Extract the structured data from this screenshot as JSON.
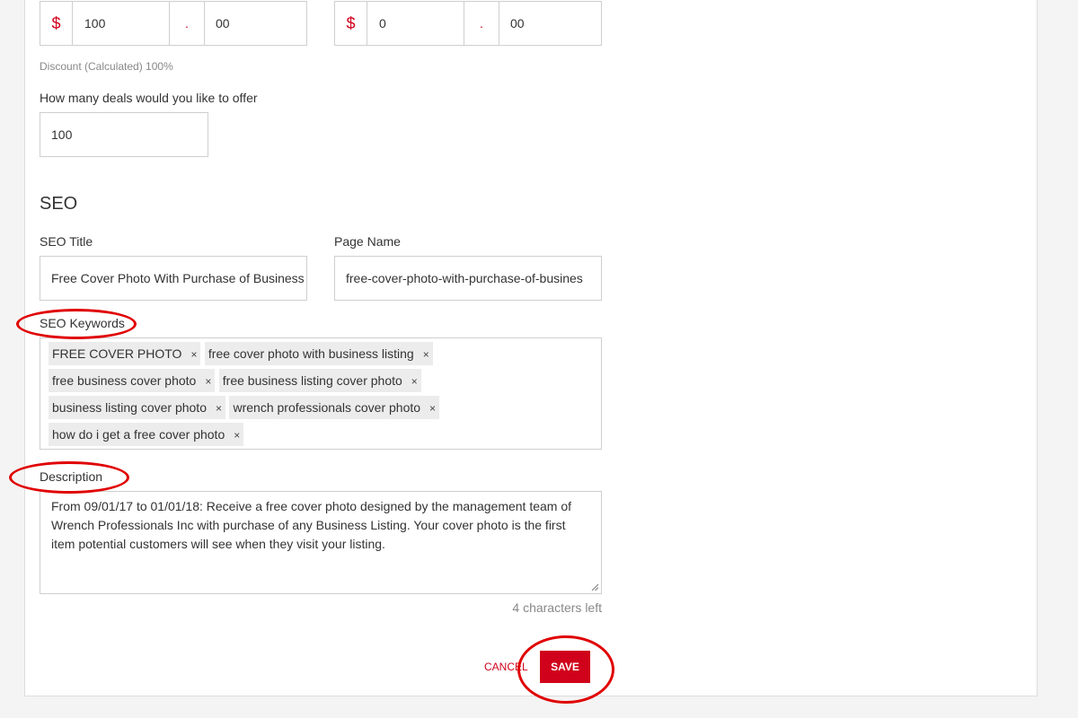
{
  "pricing": {
    "original": {
      "currency": "$",
      "dollars": "100",
      "separator": ".",
      "cents": "00"
    },
    "deal": {
      "currency": "$",
      "dollars": "0",
      "separator": ".",
      "cents": "00"
    },
    "discount_text": "Discount (Calculated) 100%"
  },
  "deals": {
    "label": "How many deals would you like to offer",
    "value": "100"
  },
  "seo": {
    "heading": "SEO",
    "title_label": "SEO Title",
    "title_value": "Free Cover Photo With Purchase of Business",
    "page_name_label": "Page Name",
    "page_name_value": "free-cover-photo-with-purchase-of-busines",
    "keywords_label": "SEO Keywords",
    "keywords": [
      "FREE COVER PHOTO",
      "free cover photo with business listing",
      "free business cover photo",
      "free business listing cover photo",
      "business listing cover photo",
      "wrench professionals cover photo",
      "how do i get a free cover photo"
    ],
    "remove_glyph": "×",
    "description_label": "Description",
    "description_value": "From 09/01/17 to 01/01/18: Receive a free cover photo designed by the management team of Wrench Professionals Inc with purchase of any Business Listing. Your cover photo is the first item potential customers will see when they visit your listing.",
    "chars_left": "4 characters left"
  },
  "actions": {
    "cancel_label": "CANCEL",
    "save_label": "SAVE"
  },
  "colors": {
    "accent": "#d0021b",
    "annotation": "#e00000"
  }
}
